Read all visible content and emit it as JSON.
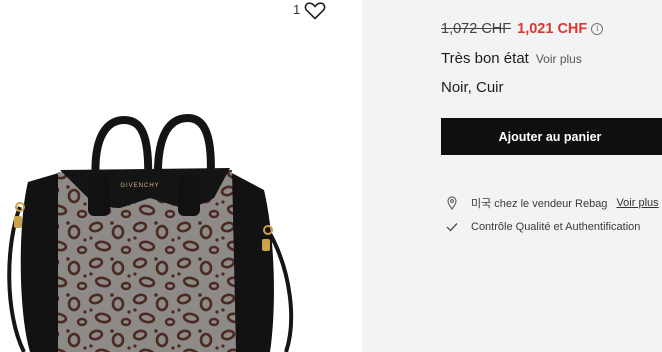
{
  "favorite": {
    "count": "1"
  },
  "product": {
    "old_price": "1,072 CHF",
    "new_price": "1,021 CHF",
    "condition": "Très bon état",
    "condition_link": "Voir plus",
    "color_material": "Noir, Cuir",
    "add_to_cart": "Ajouter au panier",
    "brand_logo_text": "GIVENCHY"
  },
  "info": {
    "seller_text": "미국 chez le vendeur Rebag",
    "seller_link": "Voir plus",
    "quality_text": "Contrôle Qualité et Authentification"
  },
  "colors": {
    "price_accent": "#d63a2f",
    "button_bg": "#0f0f0f",
    "panel_bg": "#f2f3f4"
  },
  "icons": {
    "favorite": "heart-outline-icon",
    "info": "info-circle-icon",
    "location": "location-pin-icon",
    "quality": "checkmark-icon"
  }
}
